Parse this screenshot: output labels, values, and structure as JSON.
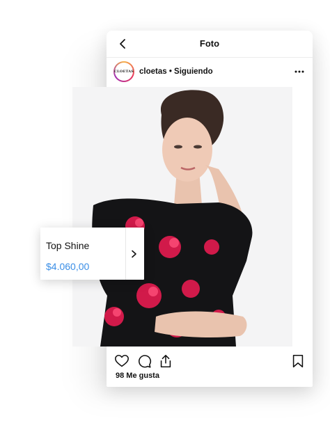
{
  "nav": {
    "title": "Foto",
    "back_icon": "chevron-left-icon"
  },
  "post": {
    "avatar_text": "CLOETAS",
    "meta": "cloetas • Siguiendo",
    "more_icon": "ellipsis-icon"
  },
  "product_tag": {
    "name": "Top Shine",
    "price": "$4.060,00",
    "price_color": "#3a8ee6",
    "chevron_icon": "chevron-right-icon"
  },
  "actions": {
    "like_icon": "heart-icon",
    "comment_icon": "comment-icon",
    "share_icon": "share-icon",
    "save_icon": "bookmark-icon"
  },
  "likes_text": "98 Me gusta"
}
